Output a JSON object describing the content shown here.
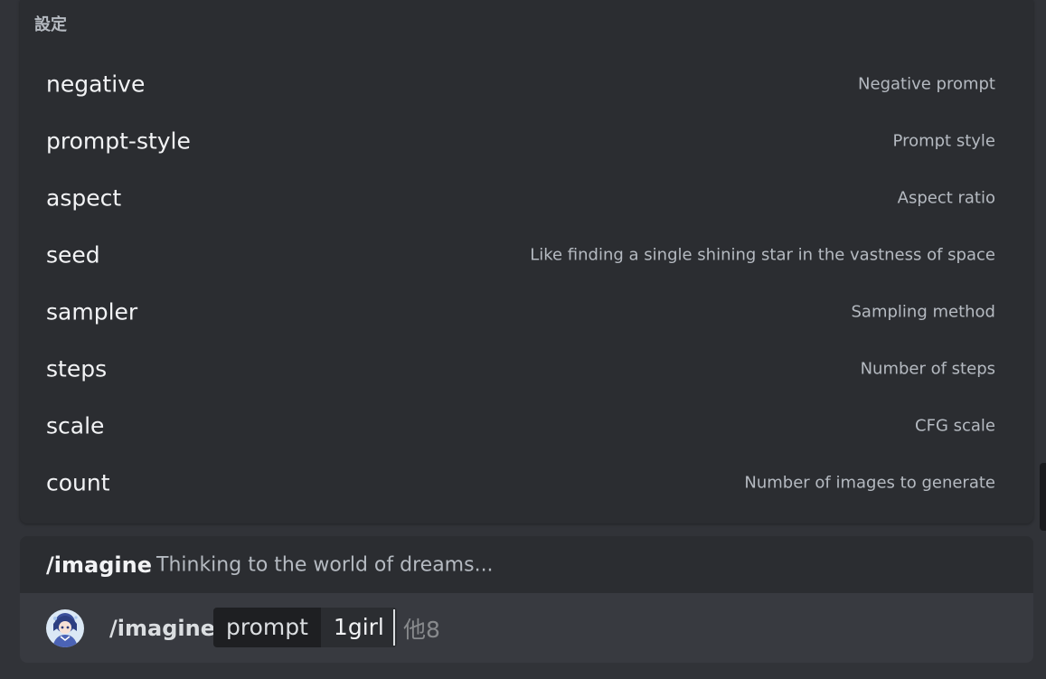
{
  "popup": {
    "title": "設定",
    "options": [
      {
        "name": "negative",
        "description": "Negative prompt"
      },
      {
        "name": "prompt-style",
        "description": "Prompt style"
      },
      {
        "name": "aspect",
        "description": "Aspect ratio"
      },
      {
        "name": "seed",
        "description": "Like finding a single shining star in the vastness of space"
      },
      {
        "name": "sampler",
        "description": "Sampling method"
      },
      {
        "name": "steps",
        "description": "Number of steps"
      },
      {
        "name": "scale",
        "description": "CFG scale"
      },
      {
        "name": "count",
        "description": "Number of images to generate"
      }
    ]
  },
  "command": {
    "name": "/imagine",
    "description": "Thinking to the world of dreams..."
  },
  "input": {
    "command": "/imagine",
    "option_key": "prompt",
    "option_value": "1girl",
    "more_label": "他8",
    "avatar_icon": "user-avatar"
  },
  "colors": {
    "background": "#313338",
    "popup": "#2b2d31",
    "input": "#383a40",
    "text_primary": "#f2f3f5",
    "text_muted": "#b5bac1"
  }
}
